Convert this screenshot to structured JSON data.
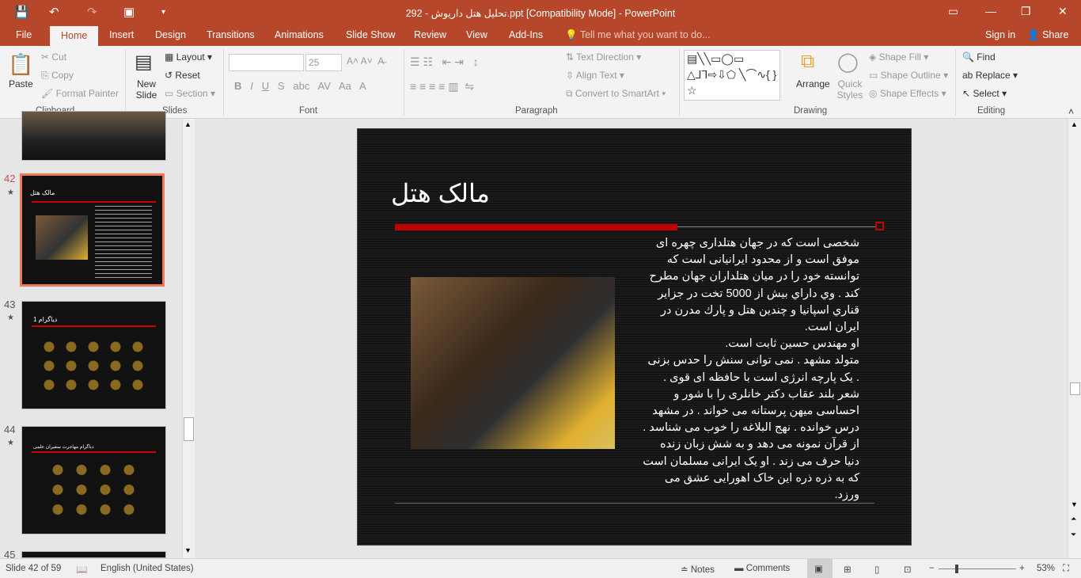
{
  "window": {
    "title": "292  -  تحلیل هتل داریوش.ppt [Compatibility Mode] - PowerPoint",
    "accent": "#b7472a"
  },
  "tabs": [
    "File",
    "Home",
    "Insert",
    "Design",
    "Transitions",
    "Animations",
    "Slide Show",
    "Review",
    "View",
    "Add-Ins"
  ],
  "tell_me": "Tell me what you want to do...",
  "account": {
    "sign_in": "Sign in",
    "share": "Share"
  },
  "ribbon": {
    "clipboard": {
      "label": "Clipboard",
      "paste": "Paste",
      "cut": "Cut",
      "copy": "Copy",
      "format_painter": "Format Painter"
    },
    "slides": {
      "label": "Slides",
      "new_slide": "New Slide",
      "layout": "Layout",
      "reset": "Reset",
      "section": "Section"
    },
    "font": {
      "label": "Font",
      "font_size": "25"
    },
    "paragraph": {
      "label": "Paragraph",
      "text_direction": "Text Direction",
      "align_text": "Align Text",
      "convert_smartart": "Convert to SmartArt"
    },
    "drawing": {
      "label": "Drawing",
      "arrange": "Arrange",
      "quick_styles": "Quick Styles",
      "shape_fill": "Shape Fill",
      "shape_outline": "Shape Outline",
      "shape_effects": "Shape Effects"
    },
    "editing": {
      "label": "Editing",
      "find": "Find",
      "replace": "Replace",
      "select": "Select"
    }
  },
  "thumbnails": [
    {
      "num": "42",
      "title": "مالک هتل",
      "selected": true
    },
    {
      "num": "43",
      "title": "دیاگرام 1"
    },
    {
      "num": "44",
      "title": "دیاگرام مهاجرت سفیران علمی"
    },
    {
      "num": "45"
    }
  ],
  "slide": {
    "title": "مالک هتل",
    "paragraphs": [
      "شخصی است که در جهان هتلداری چهره ای موفق است و از محدود ایرانیانی است که توانسته خود را در میان هتلداران جهان مطرح کند . وي داراي بيش از 5000 تخت در جزاير قناري اسپانيا و چندين هتل و پارك مدرن در ايران است.",
      "او مهندس حسين ثابت است.",
      "متولد مشهد . نمی توانی سنش را حدس بزنی . یک پارچه انرژی است با حافظه ای قوی . شعر بلند عقاب دکتر خانلری را با شور و احساسی میهن پرستانه می خواند . در مشهد درس خوانده . نهج البلاغه را خوب می شناسد . از قرآن نمونه می دهد و به شش زبان زنده دنیا حرف می زند . او یک ایرانی مسلمان است که به ذره ذره این خاک اهورایی عشق می ورزد."
    ]
  },
  "status": {
    "slide": "Slide 42 of 59",
    "language": "English (United States)",
    "notes": "Notes",
    "comments": "Comments",
    "zoom": "53%"
  }
}
